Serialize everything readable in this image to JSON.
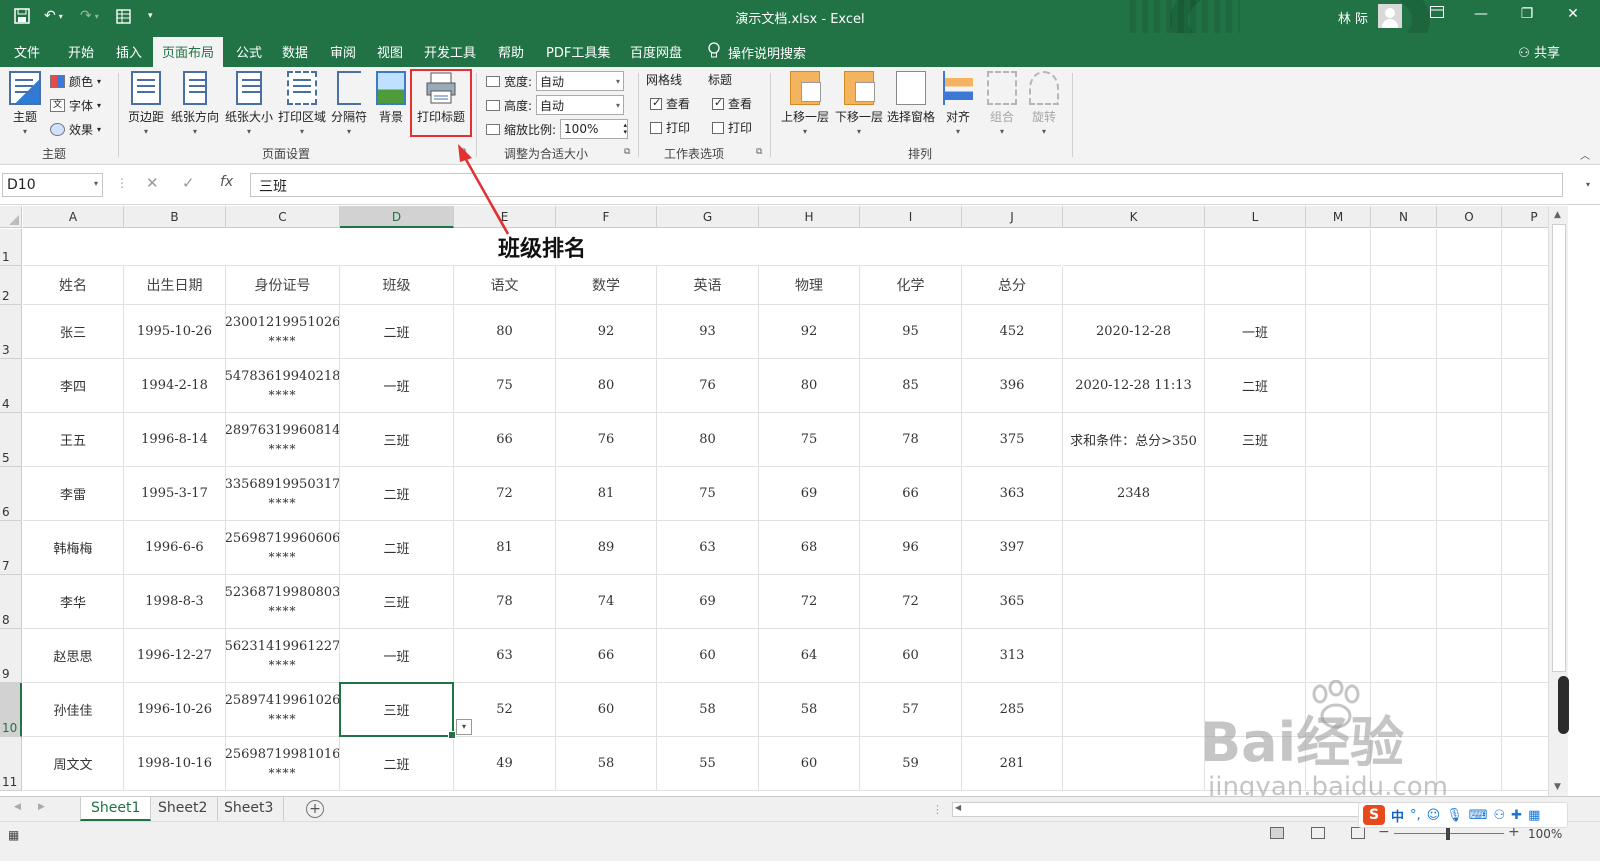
{
  "titlebar": {
    "title": "演示文档.xlsx  -  Excel",
    "user": "林 际",
    "icons": [
      "save-icon",
      "undo-icon",
      "redo-icon",
      "form-icon",
      "customize-icon"
    ],
    "window_controls": [
      "ribbon-display-icon",
      "minimize-icon",
      "restore-icon",
      "close-icon"
    ]
  },
  "menu": {
    "tabs": [
      "文件",
      "开始",
      "插入",
      "页面布局",
      "公式",
      "数据",
      "审阅",
      "视图",
      "开发工具",
      "帮助",
      "PDF工具集",
      "百度网盘"
    ],
    "active": "页面布局",
    "tell_me": "操作说明搜索",
    "share": "共享"
  },
  "ribbon": {
    "themes": {
      "theme_btn": "主题",
      "colors": "颜色",
      "fonts": "字体",
      "effects": "效果",
      "label": "主题"
    },
    "page_setup": {
      "margins": "页边距",
      "orientation": "纸张方向",
      "size": "纸张大小",
      "print_area": "打印区域",
      "breaks": "分隔符",
      "background": "背景",
      "print_titles": "打印标题",
      "label": "页面设置"
    },
    "scale": {
      "width_label": "宽度:",
      "width_value": "自动",
      "height_label": "高度:",
      "height_value": "自动",
      "scale_label": "缩放比例:",
      "scale_value": "100%",
      "label": "调整为合适大小"
    },
    "sheet_options": {
      "gridlines": "网格线",
      "headings": "标题",
      "view": "查看",
      "print": "打印",
      "label": "工作表选项"
    },
    "arrange": {
      "bring_forward": "上移一层",
      "send_backward": "下移一层",
      "selection_pane": "选择窗格",
      "align": "对齐",
      "group": "组合",
      "rotate": "旋转",
      "label": "排列"
    }
  },
  "formula_bar": {
    "name_box": "D10",
    "content": "三班"
  },
  "sheet": {
    "columns": [
      "A",
      "B",
      "C",
      "D",
      "E",
      "F",
      "G",
      "H",
      "I",
      "J",
      "K",
      "L",
      "M",
      "N",
      "O",
      "P"
    ],
    "selected_column": "D",
    "selected_row": "10",
    "rows": [
      "1",
      "2",
      "3",
      "4",
      "5",
      "6",
      "7",
      "8",
      "9",
      "10",
      "11"
    ],
    "title": "班级排名",
    "headers": [
      "姓名",
      "出生日期",
      "身份证号",
      "班级",
      "语文",
      "数学",
      "英语",
      "物理",
      "化学",
      "总分"
    ],
    "records": [
      {
        "name": "张三",
        "dob": "1995-10-26",
        "id": "23001219951026",
        "mask": "****",
        "class": "二班",
        "chinese": "80",
        "math": "92",
        "english": "93",
        "physics": "92",
        "chemistry": "95",
        "total": "452",
        "k": "2020-12-28",
        "l": "一班"
      },
      {
        "name": "李四",
        "dob": "1994-2-18",
        "id": "54783619940218",
        "mask": "****",
        "class": "一班",
        "chinese": "75",
        "math": "80",
        "english": "76",
        "physics": "80",
        "chemistry": "85",
        "total": "396",
        "k": "2020-12-28  11:13",
        "l": "二班"
      },
      {
        "name": "王五",
        "dob": "1996-8-14",
        "id": "28976319960814",
        "mask": "****",
        "class": "三班",
        "chinese": "66",
        "math": "76",
        "english": "80",
        "physics": "75",
        "chemistry": "78",
        "total": "375",
        "k": "求和条件：总分>350",
        "l": "三班"
      },
      {
        "name": "李雷",
        "dob": "1995-3-17",
        "id": "33568919950317",
        "mask": "****",
        "class": "二班",
        "chinese": "72",
        "math": "81",
        "english": "75",
        "physics": "69",
        "chemistry": "66",
        "total": "363",
        "k": "2348",
        "l": ""
      },
      {
        "name": "韩梅梅",
        "dob": "1996-6-6",
        "id": "25698719960606",
        "mask": "****",
        "class": "二班",
        "chinese": "81",
        "math": "89",
        "english": "63",
        "physics": "68",
        "chemistry": "96",
        "total": "397",
        "k": "",
        "l": ""
      },
      {
        "name": "李华",
        "dob": "1998-8-3",
        "id": "52368719980803",
        "mask": "****",
        "class": "三班",
        "chinese": "78",
        "math": "74",
        "english": "69",
        "physics": "72",
        "chemistry": "72",
        "total": "365",
        "k": "",
        "l": ""
      },
      {
        "name": "赵思思",
        "dob": "1996-12-27",
        "id": "56231419961227",
        "mask": "****",
        "class": "一班",
        "chinese": "63",
        "math": "66",
        "english": "60",
        "physics": "64",
        "chemistry": "60",
        "total": "313",
        "k": "",
        "l": ""
      },
      {
        "name": "孙佳佳",
        "dob": "1996-10-26",
        "id": "25897419961026",
        "mask": "****",
        "class": "三班",
        "chinese": "52",
        "math": "60",
        "english": "58",
        "physics": "58",
        "chemistry": "57",
        "total": "285",
        "k": "",
        "l": ""
      },
      {
        "name": "周文文",
        "dob": "1998-10-16",
        "id": "25698719981016",
        "mask": "****",
        "class": "二班",
        "chinese": "49",
        "math": "58",
        "english": "55",
        "physics": "60",
        "chemistry": "59",
        "total": "281",
        "k": "",
        "l": ""
      }
    ],
    "tabs": [
      "Sheet1",
      "Sheet2",
      "Sheet3"
    ],
    "active_tab": "Sheet1"
  },
  "status": {
    "zoom": "100%"
  },
  "ime": {
    "logo": "S",
    "mode": "中"
  },
  "watermark": {
    "brand": "Bai经验",
    "url": "jingyan.baidu.com"
  },
  "colors": {
    "excel_green": "#217346",
    "highlight_red": "#e33030"
  }
}
